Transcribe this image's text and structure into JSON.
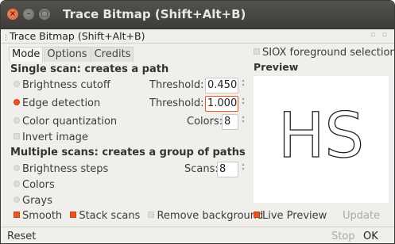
{
  "window": {
    "title": "Trace Bitmap (Shift+Alt+B)",
    "dock_title": "Trace Bitmap (Shift+Alt+B)"
  },
  "tabs": [
    {
      "label": "Mode",
      "active": true
    },
    {
      "label": "Options",
      "active": false
    },
    {
      "label": "Credits",
      "active": false
    }
  ],
  "single_scan": {
    "heading": "Single scan: creates a path",
    "brightness_cutoff": {
      "label": "Brightness cutoff",
      "selected": false,
      "field_label": "Threshold:",
      "value": "0.450"
    },
    "edge_detection": {
      "label": "Edge detection",
      "selected": true,
      "field_label": "Threshold:",
      "value": "1.000"
    },
    "color_quantization": {
      "label": "Color quantization",
      "selected": false,
      "field_label": "Colors:",
      "value": "8"
    },
    "invert_image": {
      "label": "Invert image",
      "checked": false
    }
  },
  "multiple_scans": {
    "heading": "Multiple scans: creates a group of paths",
    "brightness_steps": {
      "label": "Brightness steps",
      "selected": false,
      "field_label": "Scans:",
      "value": "8"
    },
    "colors": {
      "label": "Colors",
      "selected": false
    },
    "grays": {
      "label": "Grays",
      "selected": false
    }
  },
  "options_row": {
    "smooth": {
      "label": "Smooth",
      "checked": true
    },
    "stack_scans": {
      "label": "Stack scans",
      "checked": true
    },
    "remove_background": {
      "label": "Remove background",
      "checked": false
    }
  },
  "right_panel": {
    "siox": {
      "label": "SIOX foreground selection",
      "checked": false
    },
    "preview_title": "Preview",
    "preview_text": "HS",
    "live_preview": {
      "label": "Live Preview",
      "checked": true
    },
    "update_label": "Update"
  },
  "buttons": {
    "reset": "Reset",
    "stop": "Stop",
    "ok": "OK"
  },
  "colors": {
    "accent": "#e95420",
    "titlebar": "#3d3c38"
  }
}
